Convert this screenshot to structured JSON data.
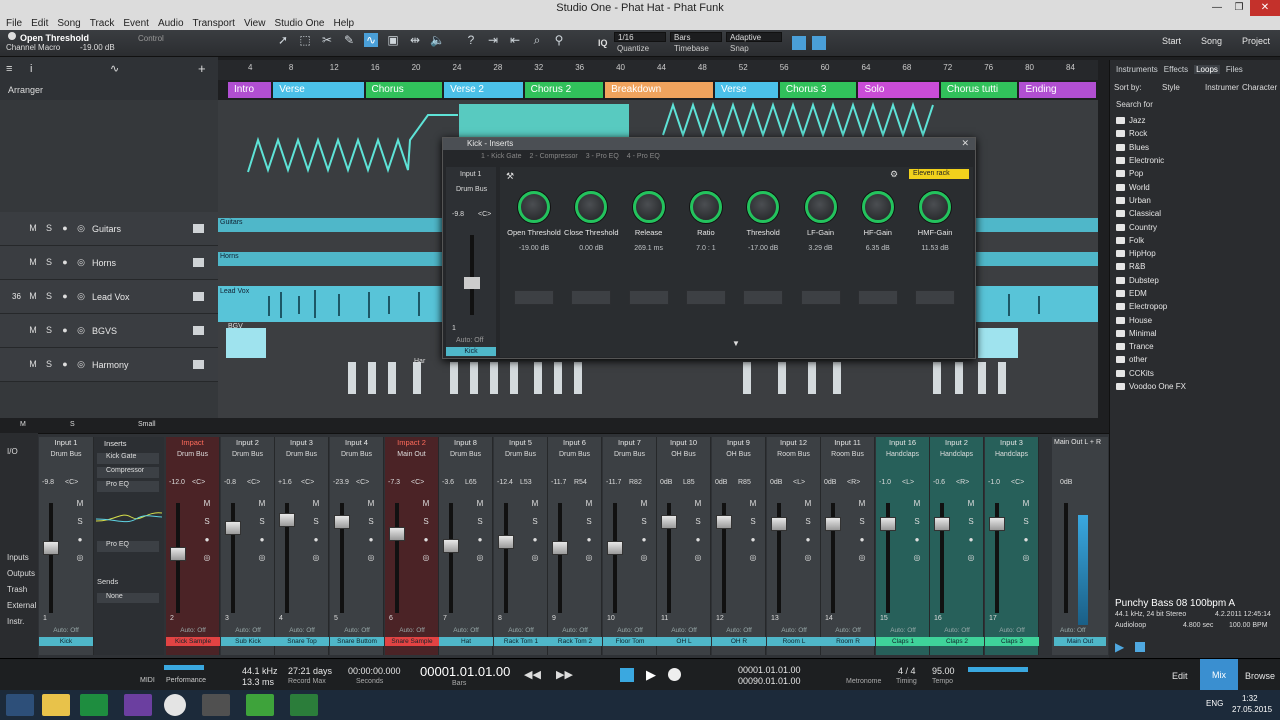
{
  "window": {
    "title": "Studio One - Phat Hat - Phat Funk"
  },
  "menu": [
    "File",
    "Edit",
    "Song",
    "Track",
    "Event",
    "Audio",
    "Transport",
    "View",
    "Studio One",
    "Help"
  ],
  "control": {
    "name": "Open Threshold",
    "sub": "Channel Macro",
    "value": "-19.00 dB",
    "label": "Control"
  },
  "quantize": {
    "value": "1/16",
    "label": "Quantize",
    "timebase": "Bars",
    "timebase_label": "Timebase",
    "snap": "Adaptive",
    "snap_label": "Snap",
    "iq": "IQ"
  },
  "topnav": [
    "Start",
    "Song",
    "Project"
  ],
  "arranger_label": "Arranger",
  "ruler": [
    "4",
    "8",
    "12",
    "16",
    "20",
    "24",
    "28",
    "32",
    "36",
    "40",
    "44",
    "48",
    "52",
    "56",
    "60",
    "64",
    "68",
    "72",
    "76",
    "80",
    "84"
  ],
  "sections": [
    {
      "label": "Intro",
      "color": "#b14fd1"
    },
    {
      "label": "Verse",
      "color": "#4bc0e8"
    },
    {
      "label": "Chorus",
      "color": "#31c15b"
    },
    {
      "label": "Verse 2",
      "color": "#4bc0e8"
    },
    {
      "label": "Chorus 2",
      "color": "#31c15b"
    },
    {
      "label": "Breakdown",
      "color": "#f0a35d"
    },
    {
      "label": "Verse",
      "color": "#4bc0e8"
    },
    {
      "label": "Chorus 3",
      "color": "#31c15b"
    },
    {
      "label": "Solo",
      "color": "#c94cd6"
    },
    {
      "label": "Chorus tutti",
      "color": "#31c15b"
    },
    {
      "label": "Ending",
      "color": "#b14fd1"
    }
  ],
  "tracks": [
    {
      "num": "",
      "name": "Guitars"
    },
    {
      "num": "",
      "name": "Horns"
    },
    {
      "num": "36",
      "name": "Lead Vox"
    },
    {
      "num": "",
      "name": "BGVS"
    },
    {
      "num": "",
      "name": "Harmony"
    }
  ],
  "track_buttons": [
    "M",
    "S",
    "●",
    "◎"
  ],
  "clips": {
    "guitars": "Guitars",
    "horns": "Horns",
    "leadvox": "Lead Vox",
    "bgv": "BGV",
    "har": "Har"
  },
  "insert_window": {
    "title": "Kick - Inserts",
    "tabs": [
      "1 - Kick Gate",
      "2 - Compressor",
      "3 - Pro EQ",
      "4 - Pro EQ"
    ],
    "preset": "Eleven rack",
    "strip": {
      "input": "Input 1",
      "bus": "Drum Bus",
      "vol": "-9.8",
      "pan": "<C>",
      "num": "1",
      "auto": "Auto: Off",
      "name": "Kick"
    },
    "knobs": [
      {
        "label": "Open Threshold",
        "value": "-19.00 dB"
      },
      {
        "label": "Close Threshold",
        "value": "0.00 dB"
      },
      {
        "label": "Release",
        "value": "269.1 ms"
      },
      {
        "label": "Ratio",
        "value": "7.0 : 1"
      },
      {
        "label": "Threshold",
        "value": "-17.00 dB"
      },
      {
        "label": "LF-Gain",
        "value": "3.29 dB"
      },
      {
        "label": "HF-Gain",
        "value": "6.35 dB"
      },
      {
        "label": "HMF-Gain",
        "value": "11.53 dB"
      }
    ]
  },
  "browser": {
    "tabs": [
      "Instruments",
      "Effects",
      "Loops",
      "Files"
    ],
    "sortby": "Sort by:",
    "style": "Style",
    "instrument": "Instrument",
    "character": "Character",
    "searchfor": "Search for",
    "folders": [
      "Jazz",
      "Rock",
      "Blues",
      "Electronic",
      "Pop",
      "World",
      "Urban",
      "Classical",
      "Country",
      "Folk",
      "HipHop",
      "R&B",
      "Dubstep",
      "EDM",
      "Electropop",
      "House",
      "Minimal",
      "Trance",
      "other",
      "CCKits",
      "Voodoo One FX"
    ],
    "file": {
      "name": "Punchy Bass 08 100bpm A",
      "format": "44.1 kHz, 24 bit Stereo",
      "date": "4.2.2011 12:45:14",
      "type": "Audioloop",
      "length": "4.800 sec",
      "tempo": "100.00 BPM"
    }
  },
  "mixer": {
    "left": [
      "I/O",
      "Inputs",
      "Outputs",
      "Trash",
      "External",
      "Instr."
    ],
    "inserts_label": "Inserts",
    "inserts": [
      "Kick Gate",
      "Compressor",
      "Pro EQ"
    ],
    "proeq": "Pro EQ",
    "sends": "Sends",
    "none": "None",
    "channels": [
      {
        "hd": "Input 1",
        "in": "Drum Bus",
        "vol": "-9.8",
        "pan": "<C>",
        "num": "1",
        "name": "Kick",
        "style": ""
      },
      {
        "hd": "Impact",
        "in": "Drum Bus",
        "vol": "-12.0",
        "pan": "<C>",
        "num": "2",
        "name": "Kick Sample",
        "style": "red"
      },
      {
        "hd": "Input 2",
        "in": "Drum Bus",
        "vol": "-0.8",
        "pan": "<C>",
        "num": "3",
        "name": "Sub Kick",
        "style": ""
      },
      {
        "hd": "Input 3",
        "in": "Drum Bus",
        "vol": "+1.6",
        "pan": "<C>",
        "num": "4",
        "name": "Snare Top",
        "style": ""
      },
      {
        "hd": "Input 4",
        "in": "Drum Bus",
        "vol": "-23.9",
        "pan": "<C>",
        "num": "5",
        "name": "Snare Buttom",
        "style": ""
      },
      {
        "hd": "Impact 2",
        "in": "Main Out",
        "vol": "-7.3",
        "pan": "<C>",
        "num": "6",
        "name": "Snare Sample",
        "style": "red"
      },
      {
        "hd": "Input 8",
        "in": "Drum Bus",
        "vol": "-3.6",
        "pan": "L65",
        "num": "7",
        "name": "Hat",
        "style": ""
      },
      {
        "hd": "Input 5",
        "in": "Drum Bus",
        "vol": "-12.4",
        "pan": "L53",
        "num": "8",
        "name": "Rack Tom 1",
        "style": ""
      },
      {
        "hd": "Input 6",
        "in": "Drum Bus",
        "vol": "-11.7",
        "pan": "R54",
        "num": "9",
        "name": "Rack Tom 2",
        "style": ""
      },
      {
        "hd": "Input 7",
        "in": "Drum Bus",
        "vol": "-11.7",
        "pan": "R82",
        "num": "10",
        "name": "Floor Tom",
        "style": ""
      },
      {
        "hd": "Input 10",
        "in": "OH Bus",
        "vol": "0dB",
        "pan": "L85",
        "num": "11",
        "name": "OH L",
        "style": ""
      },
      {
        "hd": "Input 9",
        "in": "OH Bus",
        "vol": "0dB",
        "pan": "R85",
        "num": "12",
        "name": "OH R",
        "style": ""
      },
      {
        "hd": "Input 12",
        "in": "Room Bus",
        "vol": "0dB",
        "pan": "<L>",
        "num": "13",
        "name": "Room L",
        "style": ""
      },
      {
        "hd": "Input 11",
        "in": "Room Bus",
        "vol": "0dB",
        "pan": "<R>",
        "num": "14",
        "name": "Room R",
        "style": ""
      },
      {
        "hd": "Input 16",
        "in": "Handclaps",
        "vol": "-1.0",
        "pan": "<L>",
        "num": "15",
        "name": "Claps 1",
        "style": "tint"
      },
      {
        "hd": "Input 2",
        "in": "Handclaps",
        "vol": "-0.6",
        "pan": "<R>",
        "num": "16",
        "name": "Claps 2",
        "style": "tint"
      },
      {
        "hd": "Input 3",
        "in": "Handclaps",
        "vol": "-1.0",
        "pan": "<C>",
        "num": "17",
        "name": "Claps 3",
        "style": "tint"
      }
    ],
    "main": {
      "hd": "Main Out L + R",
      "vol": "0dB",
      "peak": "-3.33",
      "peak2": "-3.33",
      "auto": "Auto: Off",
      "name": "Main Out"
    },
    "footer": {
      "m": "M",
      "s": "S",
      "small": "Small"
    }
  },
  "transport": {
    "midi": "MIDI",
    "performance": "Performance",
    "rate": "44.1 kHz",
    "latency": "13.3 ms",
    "days": "27:21 days",
    "record_max": "Record Max",
    "seconds_val": "00:00:00.000",
    "seconds": "Seconds",
    "position": "00001.01.01.00",
    "bars": "Bars",
    "loop_start": "00001.01.01.00",
    "loop_end": "00090.01.01.00",
    "metronome": "Metronome",
    "timesig": "4 / 4",
    "timing": "Timing",
    "tempo_val": "95.00",
    "tempo": "Tempo",
    "edit": "Edit",
    "mix": "Mix",
    "browse": "Browse"
  },
  "taskbar": {
    "lang": "ENG",
    "time": "1:32",
    "date": "27.05.2015"
  }
}
